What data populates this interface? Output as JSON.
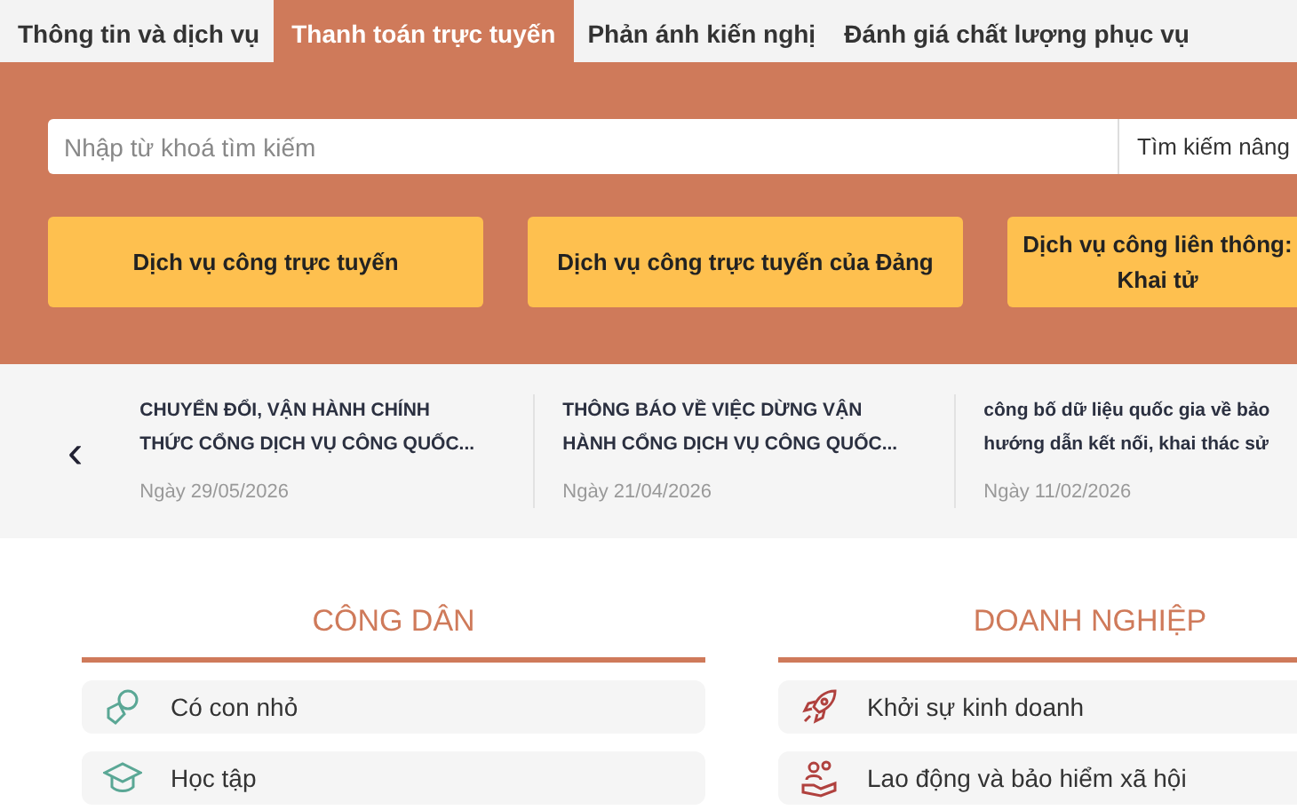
{
  "tabs": [
    {
      "label": "Thông tin và dịch vụ",
      "selected": false
    },
    {
      "label": "Thanh toán trực tuyến",
      "selected": true
    },
    {
      "label": "Phản ánh kiến nghị",
      "selected": false
    },
    {
      "label": "Đánh giá chất lượng phục vụ",
      "selected": false
    }
  ],
  "search": {
    "placeholder": "Nhập từ khoá tìm kiếm",
    "advanced": "Tìm kiếm nâng"
  },
  "service_buttons": [
    {
      "label": "Dịch vụ công trực tuyến"
    },
    {
      "label": "Dịch vụ công trực tuyến của Đảng"
    },
    {
      "label": "Dịch vụ công liên thông:\nKhai tử"
    }
  ],
  "news": {
    "prev": "‹",
    "items": [
      {
        "title": "CHUYỂN ĐỔI, VẬN HÀNH CHÍNH\nTHỨC CỔNG DỊCH VỤ CÔNG QUỐC...",
        "date": "Ngày 29/05/2026"
      },
      {
        "title": "THÔNG BÁO VỀ VIỆC DỪNG VẬN\nHÀNH CỔNG DỊCH VỤ CÔNG QUỐC...",
        "date": "Ngày 21/04/2026"
      },
      {
        "title": "công bố dữ liệu quốc gia về bảo\nhướng dẫn kết nối, khai thác sử",
        "date": "Ngày 11/02/2026"
      }
    ]
  },
  "sections": [
    {
      "title": "CÔNG DÂN",
      "items": [
        {
          "label": "Có con nhỏ",
          "kind": "baby"
        },
        {
          "label": "Học tập",
          "kind": "study"
        }
      ]
    },
    {
      "title": "DOANH NGHIỆP",
      "items": [
        {
          "label": "Khởi sự kinh doanh",
          "kind": "rocket"
        },
        {
          "label": "Lao động và bảo hiểm xã hội",
          "kind": "labor"
        }
      ]
    }
  ]
}
